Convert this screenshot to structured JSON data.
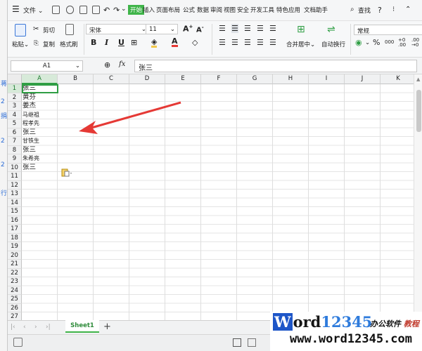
{
  "menu": {
    "file_label": "文件",
    "tabs": [
      "开始",
      "插入",
      "页面布局",
      "公式",
      "数据",
      "审阅",
      "视图",
      "安全",
      "开发工具",
      "特色应用",
      "文档助手"
    ],
    "active_tab": "开始",
    "search_label": "查找",
    "help_glyph": "?"
  },
  "ribbon": {
    "paste_label": "粘贴",
    "cut_label": "剪切",
    "copy_label": "复制",
    "format_painter_label": "格式刷",
    "font_name": "宋体",
    "font_size": "11",
    "bold": "B",
    "italic": "I",
    "underline": "U",
    "merge_center_label": "合并居中",
    "wrap_text_label": "自动换行",
    "number_format": "常规",
    "percent_glyph": "%"
  },
  "formula_bar": {
    "cell_ref": "A1",
    "fx_label": "fx",
    "content": "张三"
  },
  "grid": {
    "columns": [
      "A",
      "B",
      "C",
      "D",
      "E",
      "F",
      "G",
      "H",
      "I",
      "J",
      "K"
    ],
    "selected_column": "A",
    "selected_row": "1",
    "row_numbers": [
      "1",
      "2",
      "3",
      "4",
      "5",
      "6",
      "7",
      "8",
      "9",
      "10",
      "11",
      "12",
      "13",
      "14",
      "15",
      "16",
      "17",
      "18",
      "19",
      "20",
      "21",
      "22",
      "23",
      "24",
      "25",
      "26",
      "27"
    ],
    "cells_a": [
      "张三",
      "黄芬",
      "姜杰",
      "马继祖",
      "程孝先",
      "张三",
      "甘铁生",
      "张三",
      "朱希亮",
      "张三"
    ]
  },
  "sheet": {
    "tab_label": "Sheet1",
    "add_glyph": "+"
  },
  "watermark": {
    "brand_w": "W",
    "brand_ord": "ord",
    "brand_num": "12345",
    "tagline_a": "办公软件",
    "tagline_b": "教程",
    "url": "www.word12345.com"
  },
  "colors": {
    "accent": "#3fb449",
    "selection_border": "#2f9e44",
    "arrow": "#e53935"
  }
}
